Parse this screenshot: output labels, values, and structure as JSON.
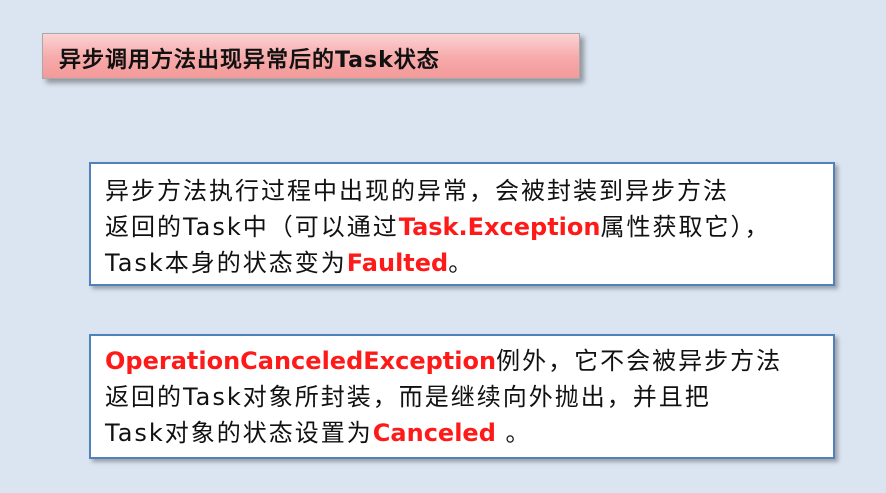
{
  "title": "异步调用方法出现异常后的Task状态",
  "box1": {
    "line1": "异步方法执行过程中出现的异常，会被封装到异步方法",
    "line2_a": "返回的Task中（可以通过",
    "line2_hl": "Task.Exception",
    "line2_b": "属性获取它），",
    "line3_a": "Task本身的状态变为",
    "line3_hl": "Faulted",
    "line3_b": "。"
  },
  "box2": {
    "line1_hl": "OperationCanceledException",
    "line1_b": "例外，它不会被异步方法",
    "line2": "返回的Task对象所封装，而是继续向外抛出，并且把",
    "line3_a": "Task对象的状态设置为",
    "line3_hl": "Canceled",
    "line3_b": " 。"
  },
  "colors": {
    "background": "#dbe5f1",
    "highlight": "#ff1a1a",
    "card_border": "#4f81bd",
    "title_fill": "#f7a9a9"
  }
}
